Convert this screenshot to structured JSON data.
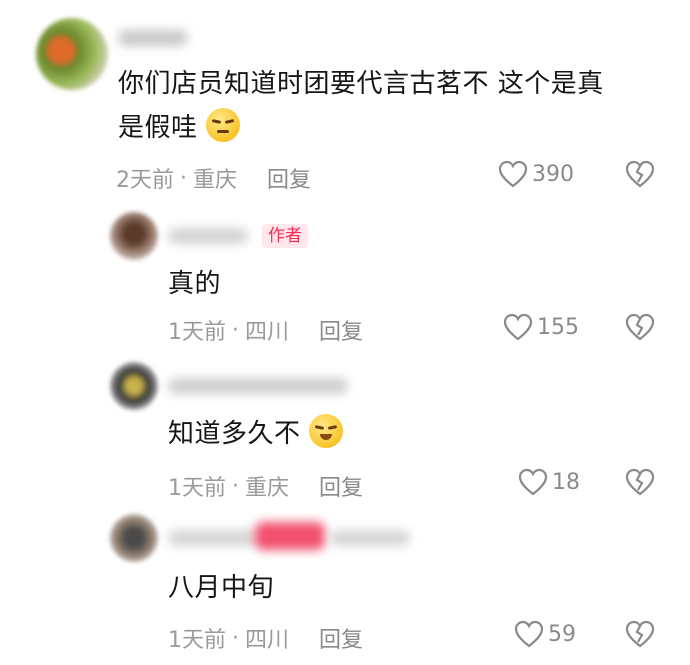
{
  "comments": [
    {
      "text_line1": "你们店员知道时团要代言古茗不  这个是真",
      "text_line2": "是假哇",
      "emoji": "unamused-face-emoji",
      "time": "2天前",
      "location": "重庆",
      "reply_label": "回复",
      "likes": "390"
    },
    {
      "author_tag": "作者",
      "text": "真的",
      "time": "1天前",
      "location": "四川",
      "reply_label": "回复",
      "likes": "155"
    },
    {
      "text": "知道多久不",
      "emoji": "smirk-face-emoji",
      "time": "1天前",
      "location": "重庆",
      "reply_label": "回复",
      "likes": "18"
    },
    {
      "text": "八月中旬",
      "time": "1天前",
      "location": "四川",
      "reply_label": "回复",
      "likes": "59"
    }
  ],
  "separator": "·",
  "colors": {
    "accent": "#fe2c55",
    "meta": "#9a9a9a"
  },
  "icons": {
    "like": "heart-outline-icon",
    "dislike": "broken-heart-icon"
  }
}
